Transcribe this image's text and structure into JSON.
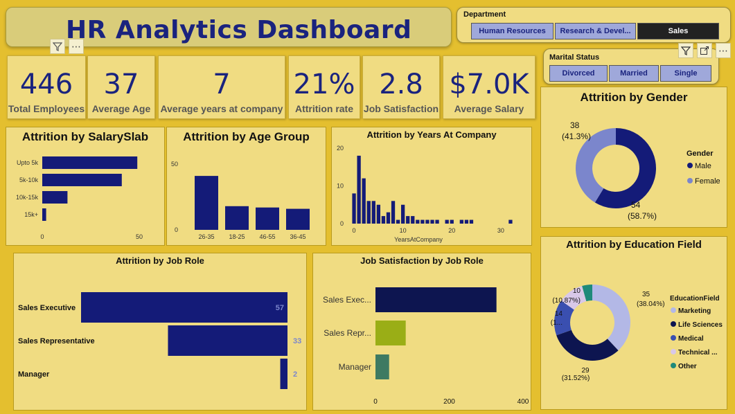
{
  "title": "HR Analytics Dashboard",
  "department_slicer": {
    "title": "Department",
    "options": [
      "Human Resources",
      "Research & Devel...",
      "Sales"
    ],
    "selected": "Sales"
  },
  "marital_slicer": {
    "title": "Marital Status",
    "options": [
      "Divorced",
      "Married",
      "Single"
    ]
  },
  "kpis": [
    {
      "value": "446",
      "label": "Total Employees"
    },
    {
      "value": "37",
      "label": "Average Age"
    },
    {
      "value": "7",
      "label": "Average years at company"
    },
    {
      "value": "21%",
      "label": "Attrition rate"
    },
    {
      "value": "2.8",
      "label": "Job Satisfaction"
    },
    {
      "value": "$7.0K",
      "label": "Average Salary"
    }
  ],
  "toolbar_icons": [
    "filter-icon",
    "more-options-icon",
    "focus-mode-icon"
  ],
  "colors": {
    "navy": "#141b78",
    "periwinkle": "#7b86cc",
    "olive": "#9aae16",
    "teal": "#3e7a62",
    "lightlavender": "#b3b8e6",
    "medblue": "#3a4fb0",
    "lightpink": "#d8c8e8",
    "tealdark": "#1f8a7a"
  },
  "chart_data": [
    {
      "id": "salary",
      "type": "bar",
      "orientation": "horizontal",
      "title": "Attrition by SalarySlab",
      "categories": [
        "Upto 5k",
        "5k-10k",
        "10k-15k",
        "15k+"
      ],
      "values": [
        49,
        41,
        13,
        2
      ],
      "xlim": [
        0,
        50
      ],
      "xticks": [
        "0",
        "50"
      ]
    },
    {
      "id": "age",
      "type": "bar",
      "title": "Attrition by Age Group",
      "categories": [
        "26-35",
        "18-25",
        "46-55",
        "36-45"
      ],
      "values": [
        41,
        18,
        17,
        16
      ],
      "ylim": [
        0,
        50
      ],
      "yticks": [
        "0",
        "50"
      ]
    },
    {
      "id": "years",
      "type": "bar",
      "title": "Attrition by Years At Company",
      "xlabel": "YearsAtCompany",
      "x": [
        0,
        1,
        2,
        3,
        4,
        5,
        6,
        7,
        8,
        9,
        10,
        11,
        12,
        13,
        14,
        15,
        16,
        17,
        19,
        20,
        22,
        23,
        24,
        32
      ],
      "values": [
        8,
        18,
        12,
        6,
        6,
        5,
        2,
        3,
        6,
        1,
        5,
        2,
        2,
        1,
        1,
        1,
        1,
        1,
        1,
        1,
        1,
        1,
        1,
        1
      ],
      "xlim": [
        -1,
        33
      ],
      "ylim": [
        0,
        20
      ],
      "xticks": [
        "0",
        "10",
        "20",
        "30"
      ],
      "yticks": [
        "0",
        "10",
        "20"
      ]
    },
    {
      "id": "gender",
      "type": "pie",
      "title": "Attrition by Gender",
      "legend_title": "Gender",
      "labels": [
        "Male",
        "Female"
      ],
      "values": [
        54,
        38
      ],
      "value_labels": [
        "54",
        "38"
      ],
      "percent_labels": [
        "(58.7%)",
        "(41.3%)"
      ]
    },
    {
      "id": "jobrole",
      "type": "bar",
      "orientation": "horizontal",
      "title": "Attrition by Job Role",
      "categories": [
        "Sales Executive",
        "Sales Representative",
        "Manager"
      ],
      "values": [
        57,
        33,
        2
      ],
      "value_labels": [
        "57",
        "33",
        "2"
      ]
    },
    {
      "id": "jobsat",
      "type": "bar",
      "orientation": "horizontal",
      "title": "Job Satisfaction by Job Role",
      "categories": [
        "Sales Exec...",
        "Sales Repr...",
        "Manager"
      ],
      "values": [
        328,
        82,
        37
      ],
      "xlim": [
        0,
        400
      ],
      "xticks": [
        "0",
        "200",
        "400"
      ]
    },
    {
      "id": "education",
      "type": "pie",
      "title": "Attrition by Education Field",
      "legend_title": "EducationField",
      "labels": [
        "Marketing",
        "Life Sciences",
        "Medical",
        "Technical ...",
        "Other"
      ],
      "values": [
        35,
        29,
        14,
        10,
        4
      ],
      "value_labels": [
        "35",
        "29",
        "14",
        "10"
      ],
      "percent_labels": [
        "(38.04%)",
        "(31.52%)",
        "(1...",
        "(10.87%)"
      ]
    }
  ]
}
